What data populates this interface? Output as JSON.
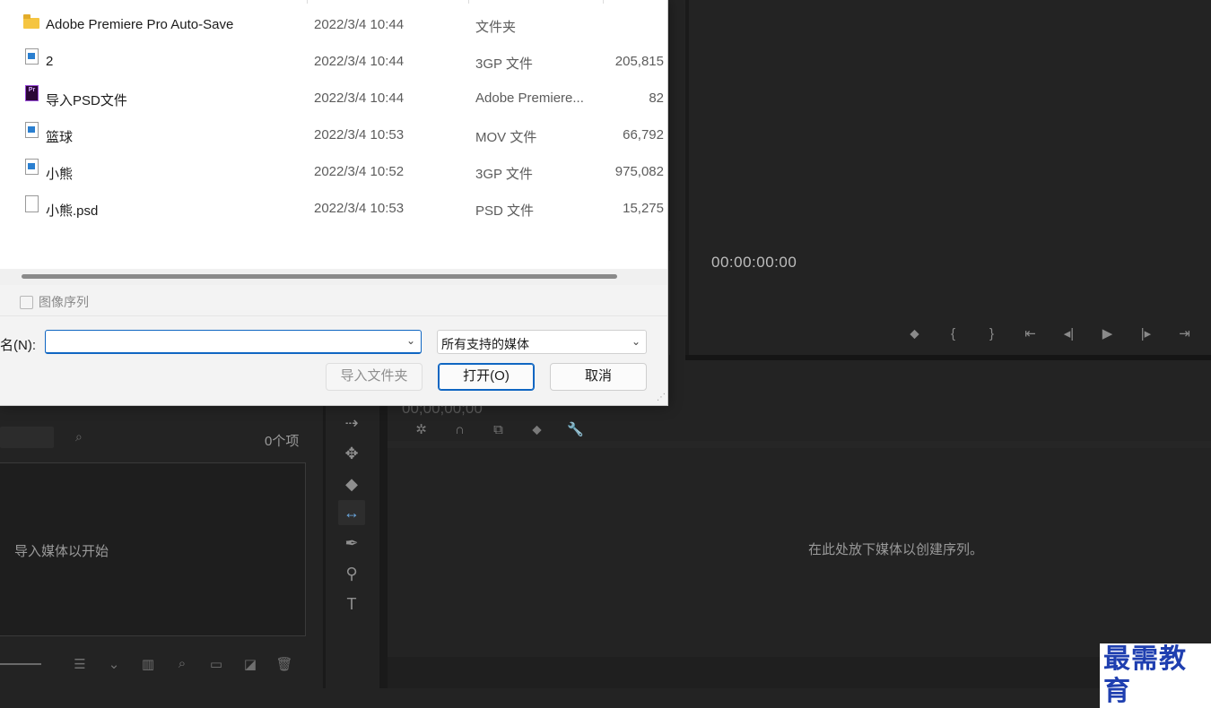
{
  "dialog": {
    "files": [
      {
        "name": "Adobe Premiere Pro Auto-Save",
        "date": "2022/3/4 10:44",
        "type": "文件夹",
        "size": "",
        "icon": "folder-icon"
      },
      {
        "name": "2",
        "date": "2022/3/4 10:44",
        "type": "3GP 文件",
        "size": "205,815",
        "icon": "video-file-icon"
      },
      {
        "name": "导入PSD文件",
        "date": "2022/3/4 10:44",
        "type": "Adobe Premiere...",
        "size": "82",
        "icon": "premiere-project-icon"
      },
      {
        "name": "篮球",
        "date": "2022/3/4 10:53",
        "type": "MOV 文件",
        "size": "66,792",
        "icon": "video-file-icon"
      },
      {
        "name": "小熊",
        "date": "2022/3/4 10:52",
        "type": "3GP 文件",
        "size": "975,082",
        "icon": "video-file-icon"
      },
      {
        "name": "小熊.psd",
        "date": "2022/3/4 10:53",
        "type": "PSD 文件",
        "size": "15,275",
        "icon": "blank-file-icon"
      }
    ],
    "image_sequence_label": "图像序列",
    "filename_label": "名(N):",
    "filename_value": "",
    "filetype_value": "所有支持的媒体",
    "import_folder_button": "导入文件夹",
    "open_button": "打开(O)",
    "cancel_button": "取消"
  },
  "premiere": {
    "program_timecode": "00:00:00:00",
    "timeline_timecode": "00;00;00;00",
    "timeline_empty": "在此处放下媒体以创建序列。",
    "project_count": "0个项",
    "project_empty": "导入媒体以开始"
  },
  "watermark": "最需教育"
}
